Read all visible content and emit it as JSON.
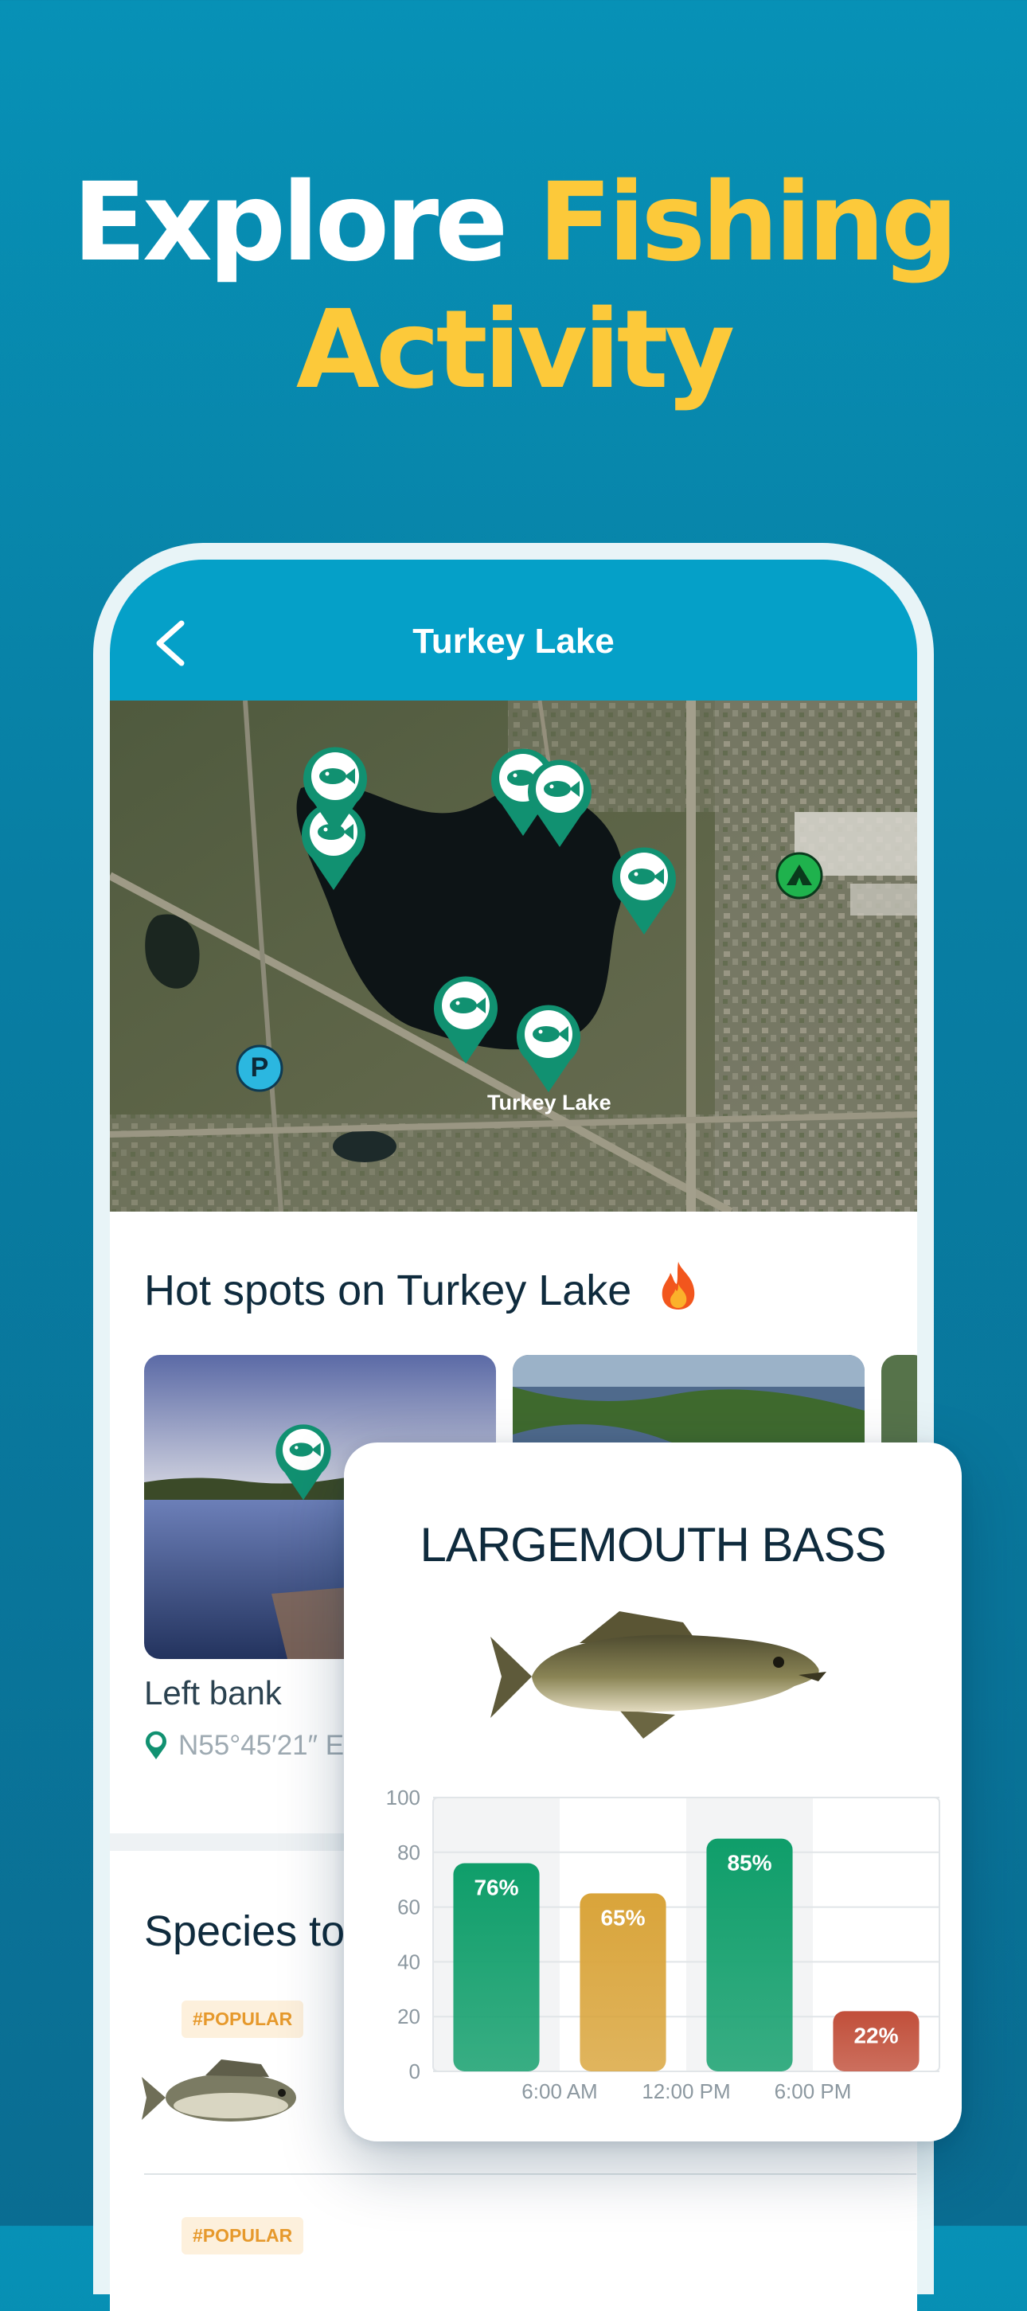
{
  "headline": {
    "line1_white": "Explore",
    "line1_yellow": "Fishing",
    "line2_yellow": "Activity"
  },
  "colors": {
    "accent_yellow": "#fcc93a",
    "nav_blue": "#05a0c8",
    "pin_green": "#119171"
  },
  "navbar": {
    "title": "Turkey Lake",
    "back_icon": "chevron-left-icon"
  },
  "map": {
    "lake_label": "Turkey Lake",
    "poi_parking": "P",
    "pins": [
      "fish-pin-icon",
      "fish-pin-icon",
      "fish-pin-icon",
      "fish-pin-icon",
      "fish-pin-icon",
      "fish-pin-icon",
      "fish-pin-icon"
    ],
    "camp_icon": "tent-icon"
  },
  "hot_spots": {
    "title": "Hot spots on Turkey Lake",
    "title_icon": "fire-icon",
    "items": [
      {
        "name": "Left bank",
        "coord": "N55°45′21″ E"
      }
    ]
  },
  "species": {
    "title": "Species to",
    "badge": "#POPULAR"
  },
  "overlay": {
    "title": "LARGEMOUTH BASS",
    "fish_icon": "largemouth-bass-icon"
  },
  "chart_data": {
    "type": "bar",
    "categories": [
      "",
      "6:00 AM",
      "12:00 PM",
      "6:00 PM"
    ],
    "x_tick_labels": [
      "6:00 AM",
      "12:00 PM",
      "6:00 PM"
    ],
    "values": [
      76,
      65,
      85,
      22
    ],
    "data_labels": [
      "76%",
      "65%",
      "85%",
      "22%"
    ],
    "bar_colors": [
      "#0f9e6a",
      "#d9a43a",
      "#0f9e6a",
      "#c14f3a"
    ],
    "ylim": [
      0,
      100
    ],
    "yticks": [
      0,
      20,
      40,
      60,
      80,
      100
    ],
    "grid": true
  }
}
